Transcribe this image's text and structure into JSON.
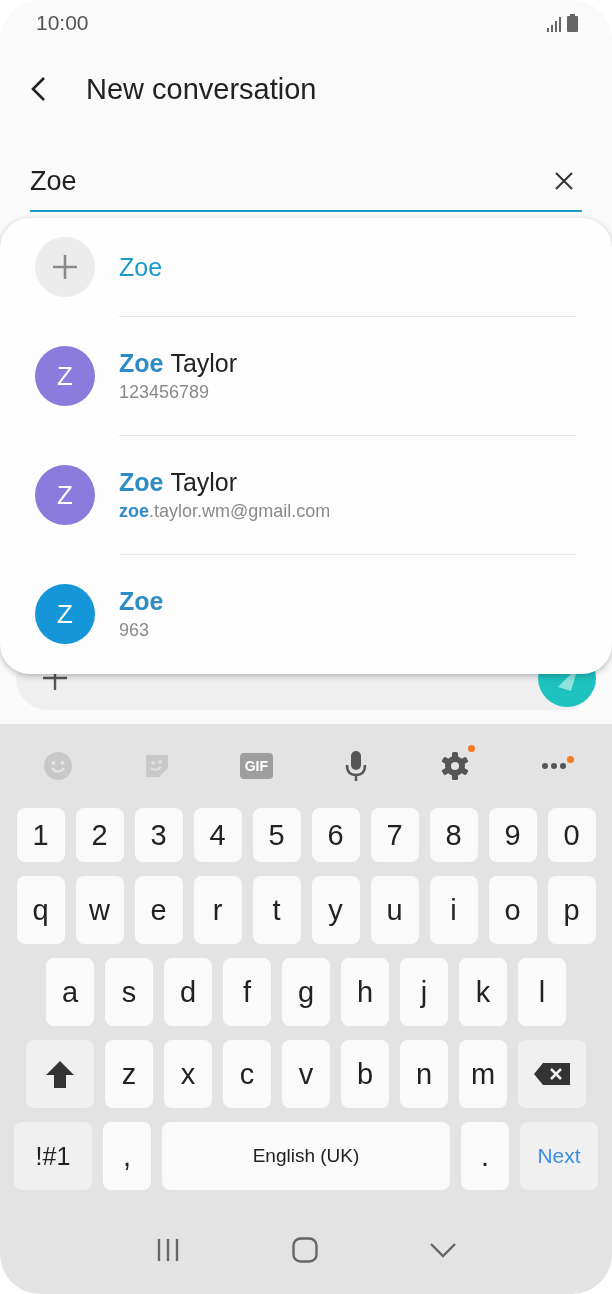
{
  "status_bar": {
    "time": "10:00"
  },
  "header": {
    "title": "New conversation"
  },
  "recipient_field": {
    "value": "Zoe"
  },
  "suggestions": [
    {
      "kind": "add",
      "match": "Zoe"
    },
    {
      "kind": "contact",
      "avatar": "Z",
      "color": "#8a7bdc",
      "name_match": "Zoe",
      "name_rest": "Taylor",
      "detail_rest": "123456789"
    },
    {
      "kind": "contact",
      "avatar": "Z",
      "color": "#8a7bdc",
      "name_match": "Zoe",
      "name_rest": "Taylor",
      "detail_match": "zoe",
      "detail_rest": ".taylor.wm@gmail.com"
    },
    {
      "kind": "contact",
      "avatar": "Z",
      "color": "#1596d8",
      "name_match": "Zoe",
      "detail_rest": "963"
    }
  ],
  "message_bar": {
    "kind": "compose"
  },
  "keyboard_toolbar": [
    {
      "kind": "emoji",
      "disabled": true,
      "badge": false
    },
    {
      "kind": "sticker",
      "disabled": true,
      "badge": false
    },
    {
      "kind": "gif",
      "label": "GIF",
      "disabled": true,
      "badge": false
    },
    {
      "kind": "mic",
      "disabled": false,
      "badge": false
    },
    {
      "kind": "settings",
      "disabled": false,
      "badge": true
    },
    {
      "kind": "more",
      "disabled": false,
      "badge": true
    }
  ],
  "keyboard_rows": [
    [
      {
        "kind": "char",
        "label": "1"
      },
      {
        "kind": "char",
        "label": "2"
      },
      {
        "kind": "char",
        "label": "3"
      },
      {
        "kind": "char",
        "label": "4"
      },
      {
        "kind": "char",
        "label": "5"
      },
      {
        "kind": "char",
        "label": "6"
      },
      {
        "kind": "char",
        "label": "7"
      },
      {
        "kind": "char",
        "label": "8"
      },
      {
        "kind": "char",
        "label": "9"
      },
      {
        "kind": "char",
        "label": "0"
      }
    ],
    [
      {
        "kind": "char",
        "label": "q"
      },
      {
        "kind": "char",
        "label": "w"
      },
      {
        "kind": "char",
        "label": "e"
      },
      {
        "kind": "char",
        "label": "r"
      },
      {
        "kind": "char",
        "label": "t"
      },
      {
        "kind": "char",
        "label": "y"
      },
      {
        "kind": "char",
        "label": "u"
      },
      {
        "kind": "char",
        "label": "i"
      },
      {
        "kind": "char",
        "label": "o"
      },
      {
        "kind": "char",
        "label": "p"
      }
    ],
    [
      {
        "kind": "char",
        "label": "a"
      },
      {
        "kind": "char",
        "label": "s"
      },
      {
        "kind": "char",
        "label": "d"
      },
      {
        "kind": "char",
        "label": "f"
      },
      {
        "kind": "char",
        "label": "g"
      },
      {
        "kind": "char",
        "label": "h"
      },
      {
        "kind": "char",
        "label": "j"
      },
      {
        "kind": "char",
        "label": "k"
      },
      {
        "kind": "char",
        "label": "l"
      }
    ],
    [
      {
        "kind": "shift"
      },
      {
        "kind": "char",
        "label": "z"
      },
      {
        "kind": "char",
        "label": "x"
      },
      {
        "kind": "char",
        "label": "c"
      },
      {
        "kind": "char",
        "label": "v"
      },
      {
        "kind": "char",
        "label": "b"
      },
      {
        "kind": "char",
        "label": "n"
      },
      {
        "kind": "char",
        "label": "m"
      },
      {
        "kind": "backspace"
      }
    ],
    [
      {
        "kind": "symbols",
        "label": "!#1"
      },
      {
        "kind": "char",
        "label": ","
      },
      {
        "kind": "space",
        "label": "English (UK)"
      },
      {
        "kind": "char",
        "label": "."
      },
      {
        "kind": "next",
        "label": "Next"
      }
    ]
  ],
  "nav_bar": [
    {
      "kind": "recents"
    },
    {
      "kind": "home"
    },
    {
      "kind": "hide"
    }
  ]
}
